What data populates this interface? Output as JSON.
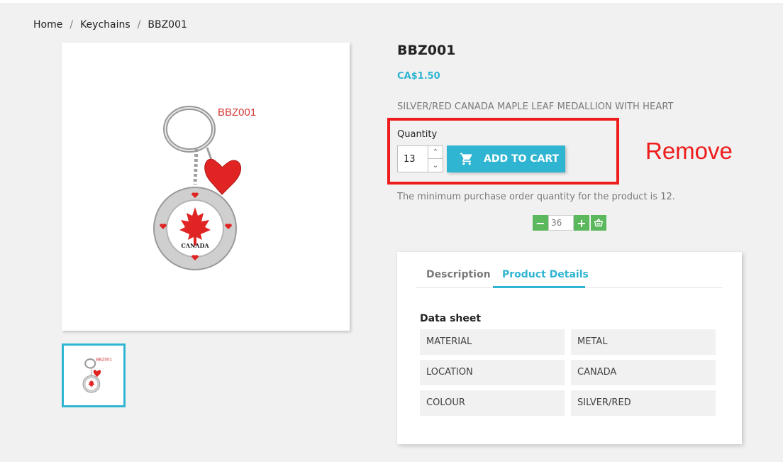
{
  "breadcrumb": {
    "items": [
      "Home",
      "Keychains",
      "BBZ001"
    ],
    "separator": "/"
  },
  "product": {
    "title": "BBZ001",
    "price": "CA$1.50",
    "short_description": "SILVER/RED CANADA MAPLE LEAF MEDALLION WITH HEART",
    "image_label": "BBZ001",
    "image_medallion_text": "CANADA"
  },
  "cart": {
    "quantity_label": "Quantity",
    "quantity_value": "13",
    "add_to_cart_label": "ADD TO CART",
    "min_message": "The minimum purchase order quantity for the product is 12."
  },
  "annotation": {
    "remove_text": "Remove",
    "color": "#ee1c1c"
  },
  "quick_qty": {
    "value": "36",
    "minus_icon": "minus-icon",
    "plus_icon": "plus-icon",
    "basket_icon": "basket-icon"
  },
  "tabs": {
    "description": "Description",
    "product_details": "Product Details",
    "active": "Product Details"
  },
  "datasheet": {
    "title": "Data sheet",
    "rows": [
      {
        "name": "MATERIAL",
        "value": "METAL"
      },
      {
        "name": "LOCATION",
        "value": "CANADA"
      },
      {
        "name": "COLOUR",
        "value": "SILVER/RED"
      }
    ]
  },
  "colors": {
    "accent": "#2fb5d2",
    "green": "#5cb85c",
    "annotation_red": "#ee1c1c"
  }
}
